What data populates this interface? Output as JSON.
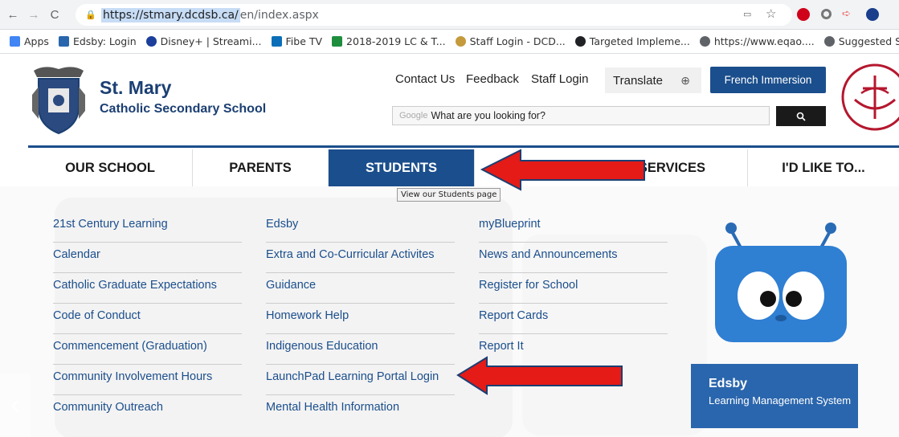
{
  "browser": {
    "url_highlighted": "https://stmary.dcdsb.ca/",
    "url_rest": "en/index.aspx",
    "bookmarks": [
      {
        "label": "Apps",
        "color": "#4285f4"
      },
      {
        "label": "Edsby: Login",
        "color": "#2a66ad"
      },
      {
        "label": "Disney+ | Streami...",
        "color": "#1b3f9a"
      },
      {
        "label": "Fibe TV",
        "color": "#0a6fb8"
      },
      {
        "label": "2018-2019 LC & T...",
        "color": "#1e8e3e"
      },
      {
        "label": "Staff Login - DCD...",
        "color": "#c59a3d"
      },
      {
        "label": "Targeted Impleme...",
        "color": "#202124"
      },
      {
        "label": "https://www.eqao....",
        "color": "#5f6368"
      },
      {
        "label": "Suggested Sites",
        "color": "#5f6368"
      }
    ]
  },
  "header": {
    "school_name": "St. Mary",
    "school_subtitle": "Catholic Secondary School",
    "links": [
      "Contact Us",
      "Feedback",
      "Staff Login"
    ],
    "translate": "Translate",
    "french_button": "French Immersion",
    "search_brand": "Google",
    "search_placeholder": "What are you looking for?"
  },
  "nav": {
    "items": [
      "OUR SCHOOL",
      "PARENTS",
      "STUDENTS",
      "SERVICES",
      "I'D LIKE TO..."
    ],
    "active": "STUDENTS",
    "tooltip": "View our Students page"
  },
  "menu": {
    "col1": [
      "21st Century Learning",
      "Calendar",
      "Catholic Graduate Expectations",
      "Code of Conduct",
      "Commencement (Graduation)",
      "Community Involvement Hours",
      "Community Outreach"
    ],
    "col2": [
      "Edsby",
      "Extra and Co-Curricular Activites",
      "Guidance",
      "Homework Help",
      "Indigenous Education",
      "LaunchPad Learning Portal Login",
      "Mental Health Information"
    ],
    "col3": [
      "myBlueprint",
      "News and Announcements",
      "Register for School",
      "Report Cards",
      "Report It"
    ]
  },
  "edsby": {
    "title": "Edsby",
    "subtitle": "Learning Management System"
  },
  "colors": {
    "brand_blue": "#1b4e8c",
    "arrow_red": "#e41b17",
    "emblem_red": "#b5172e"
  }
}
